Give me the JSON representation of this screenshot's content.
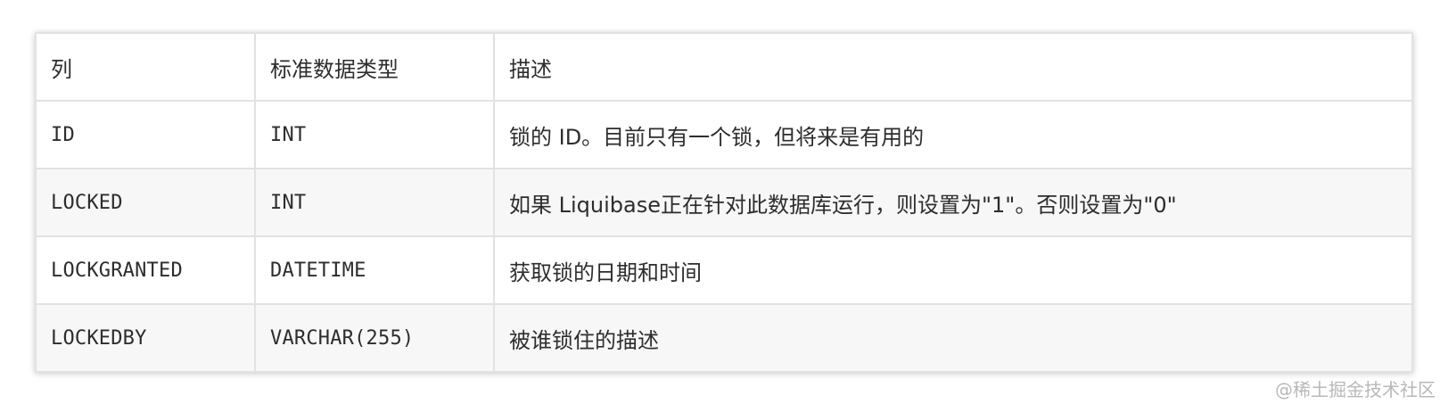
{
  "table": {
    "headers": [
      "列",
      "标准数据类型",
      "描述"
    ],
    "rows": [
      {
        "column": "ID",
        "type": "INT",
        "description": "锁的 ID。目前只有一个锁，但将来是有用的"
      },
      {
        "column": "LOCKED",
        "type": "INT",
        "description": "如果 Liquibase正在针对此数据库运行，则设置为\"1\"。否则设置为\"0\""
      },
      {
        "column": "LOCKGRANTED",
        "type": "DATETIME",
        "description": "获取锁的日期和时间"
      },
      {
        "column": "LOCKEDBY",
        "type": "VARCHAR(255)",
        "description": "被谁锁住的描述"
      }
    ]
  },
  "watermark": "@稀土掘金技术社区",
  "colors": {
    "border": "#e2e2e2",
    "row_alt": "#f7f7f7",
    "text": "#2d2d2d",
    "watermark": "#b8b8b8"
  }
}
